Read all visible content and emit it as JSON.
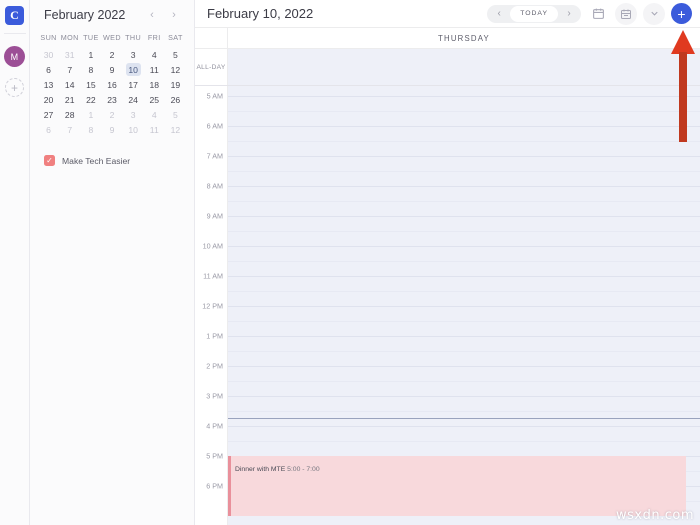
{
  "rail": {
    "logo_letter": "C",
    "avatar_letter": "M",
    "add_icon": "+"
  },
  "sidebar": {
    "mini_calendar": {
      "title": "February 2022",
      "prev_icon": "‹",
      "next_icon": "›",
      "weekdays": [
        "SUN",
        "MON",
        "TUE",
        "WED",
        "THU",
        "FRI",
        "SAT"
      ],
      "weeks": [
        [
          {
            "d": "30",
            "m": true
          },
          {
            "d": "31",
            "m": true
          },
          {
            "d": "1",
            "m": false
          },
          {
            "d": "2",
            "m": false
          },
          {
            "d": "3",
            "m": false
          },
          {
            "d": "4",
            "m": false
          },
          {
            "d": "5",
            "m": false
          }
        ],
        [
          {
            "d": "6",
            "m": false
          },
          {
            "d": "7",
            "m": false
          },
          {
            "d": "8",
            "m": false
          },
          {
            "d": "9",
            "m": false
          },
          {
            "d": "10",
            "m": false,
            "sel": true
          },
          {
            "d": "11",
            "m": false
          },
          {
            "d": "12",
            "m": false
          }
        ],
        [
          {
            "d": "13",
            "m": false
          },
          {
            "d": "14",
            "m": false
          },
          {
            "d": "15",
            "m": false
          },
          {
            "d": "16",
            "m": false
          },
          {
            "d": "17",
            "m": false
          },
          {
            "d": "18",
            "m": false
          },
          {
            "d": "19",
            "m": false
          }
        ],
        [
          {
            "d": "20",
            "m": false
          },
          {
            "d": "21",
            "m": false
          },
          {
            "d": "22",
            "m": false
          },
          {
            "d": "23",
            "m": false
          },
          {
            "d": "24",
            "m": false
          },
          {
            "d": "25",
            "m": false
          },
          {
            "d": "26",
            "m": false
          }
        ],
        [
          {
            "d": "27",
            "m": false
          },
          {
            "d": "28",
            "m": false
          },
          {
            "d": "1",
            "m": true
          },
          {
            "d": "2",
            "m": true
          },
          {
            "d": "3",
            "m": true
          },
          {
            "d": "4",
            "m": true
          },
          {
            "d": "5",
            "m": true
          }
        ],
        [
          {
            "d": "6",
            "m": true
          },
          {
            "d": "7",
            "m": true
          },
          {
            "d": "8",
            "m": true
          },
          {
            "d": "9",
            "m": true
          },
          {
            "d": "10",
            "m": true
          },
          {
            "d": "11",
            "m": true
          },
          {
            "d": "12",
            "m": true
          }
        ]
      ]
    },
    "calendars": [
      {
        "label": "Make Tech Easier",
        "color": "#f08080",
        "checked": true,
        "check_glyph": "✓"
      }
    ]
  },
  "toolbar": {
    "date_title": "February 10, 2022",
    "prev_icon": "‹",
    "today_label": "TODAY",
    "next_icon": "›",
    "icons": [
      "calendar-day-icon",
      "calendar-month-icon",
      "chevron-down-icon"
    ],
    "chevron_glyph": "∨",
    "add_label": "+",
    "accent_color": "#3b5bdb"
  },
  "calendar_view": {
    "day_label": "THURSDAY",
    "allday_label": "ALL-DAY",
    "hours": [
      "5 AM",
      "6 AM",
      "7 AM",
      "8 AM",
      "9 AM",
      "10 AM",
      "11 AM",
      "12 PM",
      "1 PM",
      "2 PM",
      "3 PM",
      "4 PM",
      "5 PM",
      "6 PM"
    ],
    "current_time_position_hour": "4 PM",
    "events": [
      {
        "title": "Dinner with MTE",
        "time": "5:00 - 7:00",
        "start_hour_index": 12,
        "duration_hours": 2,
        "bg_color": "#f8d9dc",
        "border_color": "#e9909b"
      }
    ]
  },
  "annotation": {
    "arrow_color": "#e03a20",
    "points_to": "add-event-button"
  },
  "watermark": {
    "text": "wsxdn.com"
  }
}
